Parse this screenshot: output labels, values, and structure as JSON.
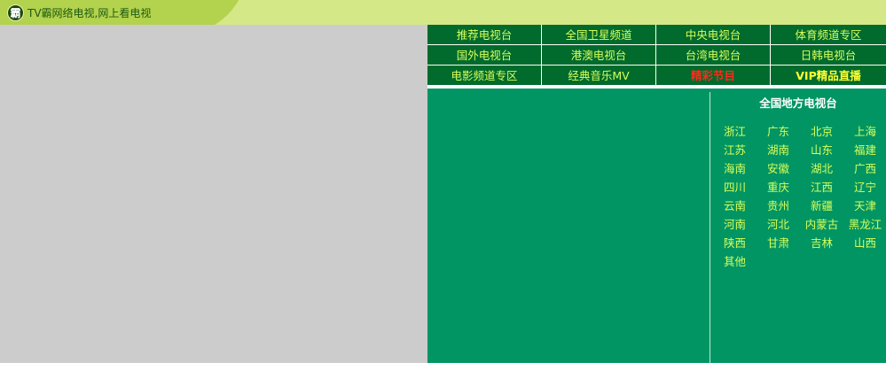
{
  "header": {
    "logo_text": "霸",
    "title": "TV霸网络电视,网上看电视"
  },
  "nav": {
    "rows": [
      [
        "推荐电视台",
        "全国卫星频道",
        "中央电视台",
        "体育频道专区"
      ],
      [
        "国外电视台",
        "港澳电视台",
        "台湾电视台",
        "日韩电视台"
      ],
      [
        "电影频道专区",
        "经典音乐MV",
        "精彩节目",
        "VIP精品直播"
      ]
    ]
  },
  "local": {
    "title": "全国地方电视台",
    "provinces": [
      "浙江",
      "广东",
      "北京",
      "上海",
      "江苏",
      "湖南",
      "山东",
      "福建",
      "海南",
      "安徽",
      "湖北",
      "广西",
      "四川",
      "重庆",
      "江西",
      "辽宁",
      "云南",
      "贵州",
      "新疆",
      "天津",
      "河南",
      "河北",
      "内蒙古",
      "黑龙江",
      "陕西",
      "甘肃",
      "吉林",
      "山西",
      "其他"
    ]
  },
  "colors": {
    "nav_bg": "#006b2c",
    "nav_text": "#d8ff5a",
    "highlight_red": "#ff2a1a",
    "highlight_gold": "#ffff33",
    "content_bg": "#009563",
    "header_bg": "#d5e888",
    "player_bg": "#cccccc"
  }
}
